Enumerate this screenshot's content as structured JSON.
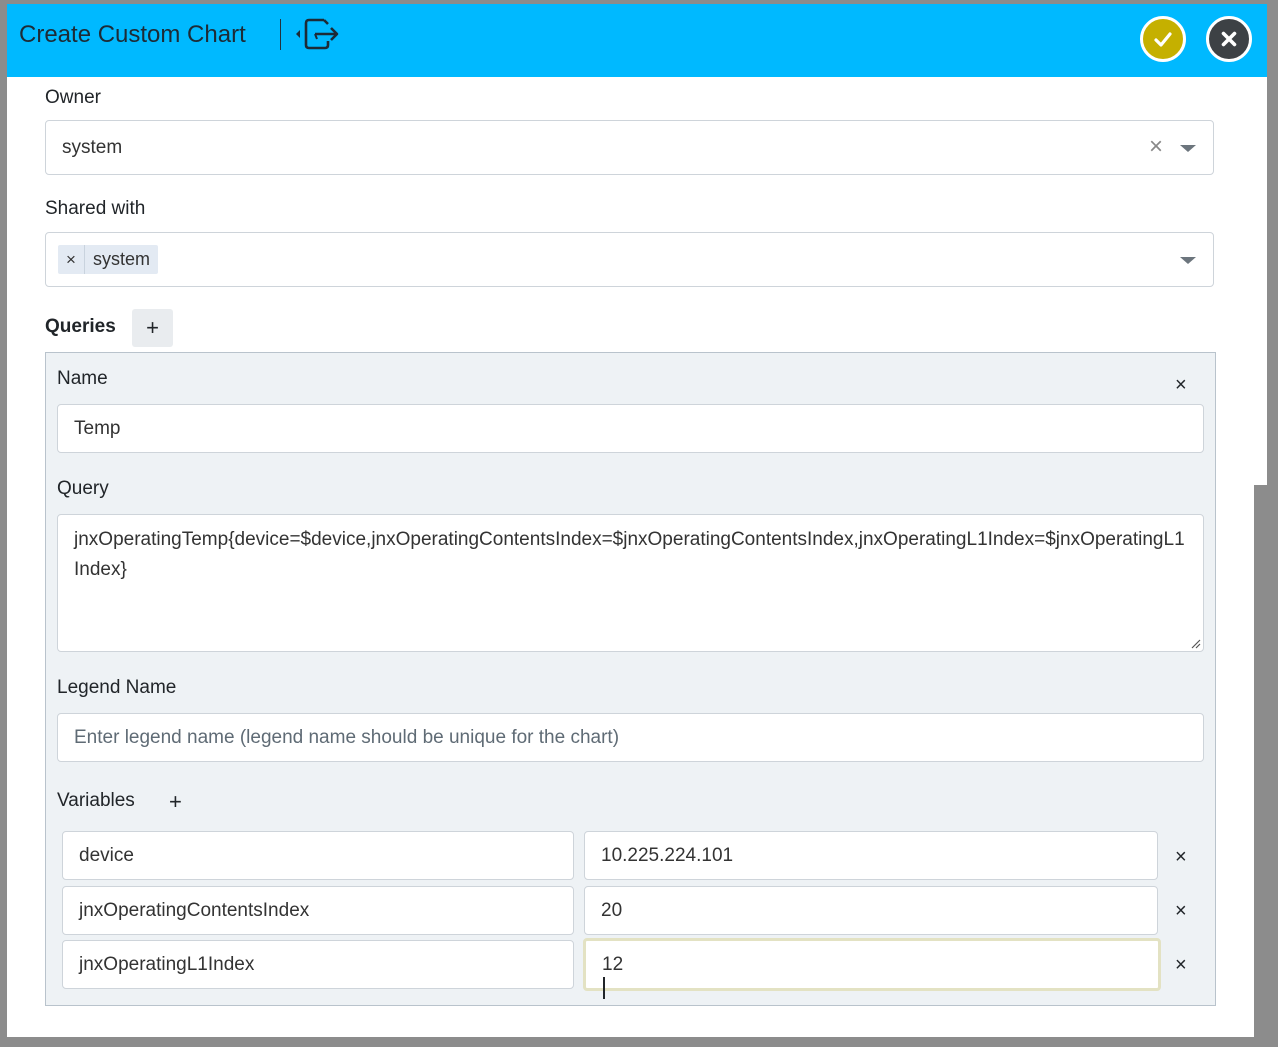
{
  "dialog": {
    "title": "Create Custom Chart",
    "colors": {
      "header": "#00b9ff",
      "confirm": "#c5b000",
      "close": "#3d4145",
      "panel": "#eef2f5"
    },
    "icons": {
      "export": "export-icon",
      "confirm": "check-icon",
      "close": "close-icon"
    }
  },
  "owner": {
    "label": "Owner",
    "value": "system",
    "clear_glyph": "×"
  },
  "shared_with": {
    "label": "Shared with",
    "chips": [
      {
        "remove_glyph": "×",
        "label": "system"
      }
    ]
  },
  "queries": {
    "label": "Queries",
    "add_glyph": "+",
    "items": [
      {
        "remove_glyph": "×",
        "name_label": "Name",
        "name_value": "Temp",
        "query_label": "Query",
        "query_value": "jnxOperatingTemp{device=$device,jnxOperatingContentsIndex=$jnxOperatingContentsIndex,jnxOperatingL1Index=$jnxOperatingL1Index}",
        "legend_label": "Legend Name",
        "legend_placeholder": "Enter legend name (legend name should be unique for the chart)",
        "variables_label": "Variables",
        "variables_add_glyph": "+",
        "variables": [
          {
            "name": "device",
            "value": "10.225.224.101",
            "remove_glyph": "×"
          },
          {
            "name": "jnxOperatingContentsIndex",
            "value": "20",
            "remove_glyph": "×"
          },
          {
            "name": "jnxOperatingL1Index",
            "value": "12",
            "remove_glyph": "×"
          }
        ]
      }
    ]
  }
}
